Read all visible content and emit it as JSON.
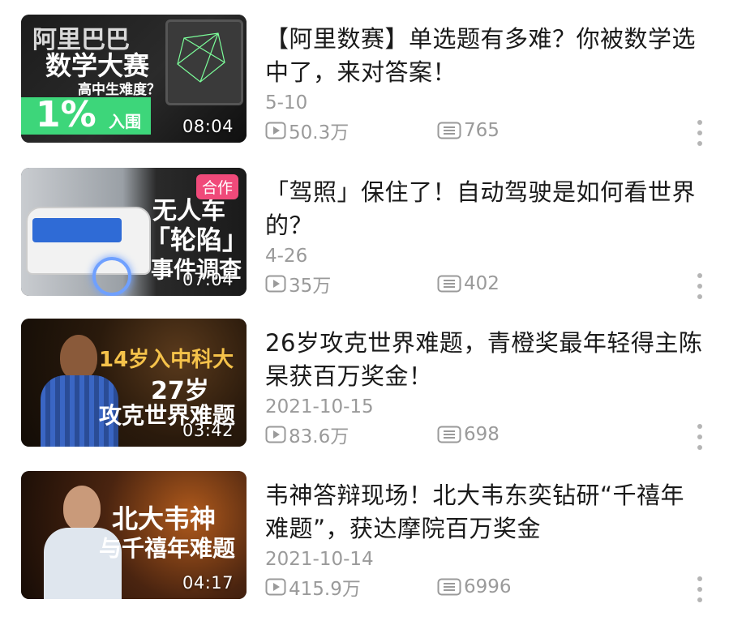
{
  "colors": {
    "accent_pink": "#f04a7a",
    "meta_gray": "#9a9a9a",
    "title_black": "#1a1a1a"
  },
  "videos": [
    {
      "title": "【阿里数赛】单选题有多难？你被数学选中了，来对答案！",
      "date": "5-10",
      "views": "50.3万",
      "comments": "765",
      "duration": "08:04",
      "badge": "",
      "thumb_text": [
        "阿里巴巴",
        "数学大赛",
        "高中生难度？",
        "1%",
        "入围"
      ]
    },
    {
      "title": "「驾照」保住了！自动驾驶是如何看世界的？",
      "date": "4-26",
      "views": "35万",
      "comments": "402",
      "duration": "07:04",
      "badge": "合作",
      "thumb_text": [
        "无人车",
        "「轮陷」",
        "事件调查"
      ]
    },
    {
      "title": "26岁攻克世界难题，青橙奖最年轻得主陈杲获百万奖金！",
      "date": "2021-10-15",
      "views": "83.6万",
      "comments": "698",
      "duration": "03:42",
      "badge": "",
      "thumb_text": [
        "14岁入中科大",
        "27岁",
        "攻克世界难题"
      ]
    },
    {
      "title": "韦神答辩现场！北大韦东奕钻研“千禧年难题”，获达摩院百万奖金",
      "date": "2021-10-14",
      "views": "415.9万",
      "comments": "6996",
      "duration": "04:17",
      "badge": "",
      "thumb_text": [
        "北大韦神",
        "与千禧年难题"
      ]
    }
  ],
  "icons": {
    "play": "play-count-icon",
    "comment": "comment-count-icon",
    "more": "more-options-icon"
  }
}
